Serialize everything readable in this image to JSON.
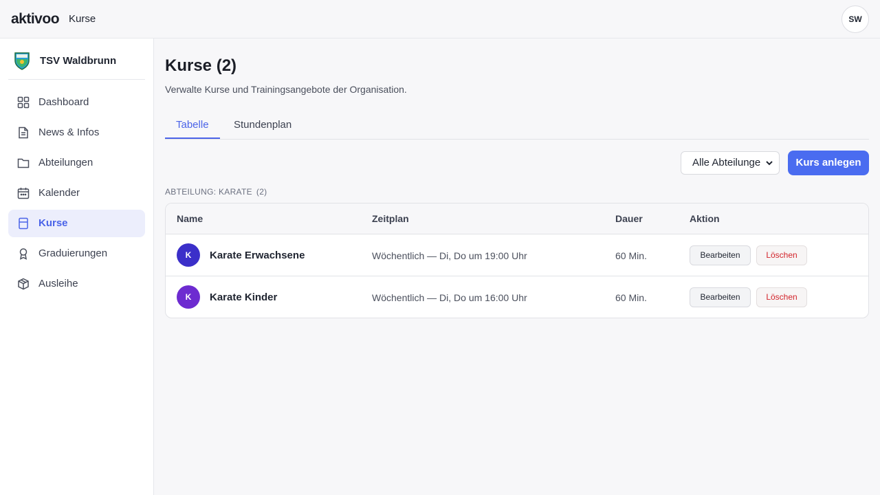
{
  "app": {
    "logo": "aktivoo",
    "title": "Kurse",
    "user_initials": "SW"
  },
  "org": {
    "name": "TSV Waldbrunn"
  },
  "sidebar": {
    "items": [
      {
        "label": "Dashboard",
        "icon": "dashboard-icon"
      },
      {
        "label": "News & Infos",
        "icon": "news-icon"
      },
      {
        "label": "Abteilungen",
        "icon": "folder-icon"
      },
      {
        "label": "Kalender",
        "icon": "calendar-icon"
      },
      {
        "label": "Kurse",
        "icon": "course-icon",
        "active": true
      },
      {
        "label": "Graduierungen",
        "icon": "award-icon"
      },
      {
        "label": "Ausleihe",
        "icon": "package-icon"
      }
    ]
  },
  "page": {
    "title": "Kurse (2)",
    "subtitle": "Verwalte Kurse und Trainingsangebote der Organisation."
  },
  "tabs": [
    {
      "label": "Tabelle",
      "active": true
    },
    {
      "label": "Stundenplan",
      "active": false
    }
  ],
  "filter": {
    "selected": "Alle Abteilunge"
  },
  "actions": {
    "create_label": "Kurs anlegen"
  },
  "group": {
    "label": "ABTEILUNG: KARATE",
    "count": "(2)"
  },
  "table": {
    "headers": {
      "name": "Name",
      "schedule": "Zeitplan",
      "duration": "Dauer",
      "action": "Aktion"
    },
    "rows": [
      {
        "initial": "K",
        "name": "Karate Erwachsene",
        "schedule": "Wöchentlich — Di, Do um 19:00 Uhr",
        "duration": "60 Min.",
        "edit": "Bearbeiten",
        "delete": "Löschen",
        "color": "#3b2fc9"
      },
      {
        "initial": "K",
        "name": "Karate Kinder",
        "schedule": "Wöchentlich — Di, Do um 16:00 Uhr",
        "duration": "60 Min.",
        "edit": "Bearbeiten",
        "delete": "Löschen",
        "color": "#6d2bd0"
      }
    ]
  },
  "colors": {
    "accent": "#4a63e8",
    "primary_button": "#4a6cf0",
    "danger": "#d2232a"
  }
}
